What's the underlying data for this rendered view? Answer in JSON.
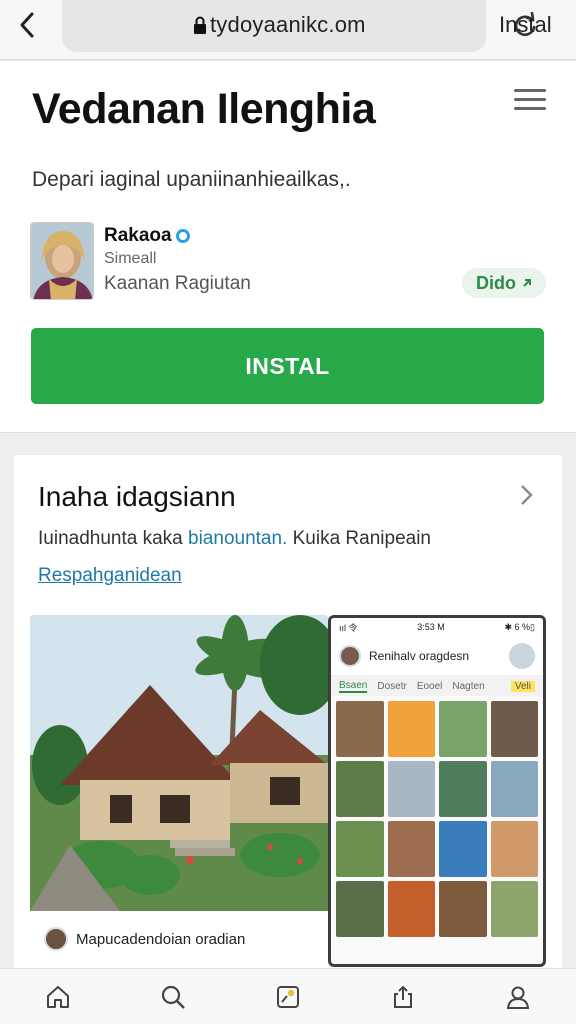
{
  "browser": {
    "url": "tydoyaanikc.om",
    "install_label": "Instal"
  },
  "app": {
    "title": "Vedanan Ilenghia",
    "description": "Depari iaginal upaniinanhieailkas,.",
    "developer": {
      "name": "Rakaoa",
      "subtitle": "Simeall",
      "category": "Kaanan Ragiutan"
    },
    "chip_label": "Dido",
    "install_button": "INSTAL"
  },
  "info": {
    "title": "Inaha idagsiann",
    "desc_before": "Iuinadhunta kaka ",
    "desc_highlight": "bianountan.",
    "desc_after": " Kuika Ranipeain",
    "link": "Respahganidean"
  },
  "screenshots": {
    "caption": "Mapucadendoian oradian",
    "phone": {
      "status_left": "ııl 令",
      "status_center": "3:53 M",
      "status_right": "✱ 6 %▯",
      "title": "Renihalv oragdesn",
      "tabs": [
        "Bsaen",
        "Dosetr",
        "Eooel",
        "Nagten",
        "Veli"
      ],
      "tile_colors": [
        "#8a6a4c",
        "#f0a13a",
        "#7aa36a",
        "#6d5a48",
        "#5d7c4a",
        "#a7b8c4",
        "#4f7d5c",
        "#89a7bd",
        "#6b8f4e",
        "#9c6e4f",
        "#3a7dbd",
        "#d09a6b",
        "#5a6e4a",
        "#c45e2d",
        "#7d5b3c",
        "#8fa36d"
      ]
    }
  },
  "nav": [
    "home-icon",
    "search-icon",
    "apps-icon",
    "share-icon",
    "profile-icon"
  ],
  "colors": {
    "install_green": "#27a849",
    "link_blue": "#1e7aa8"
  }
}
